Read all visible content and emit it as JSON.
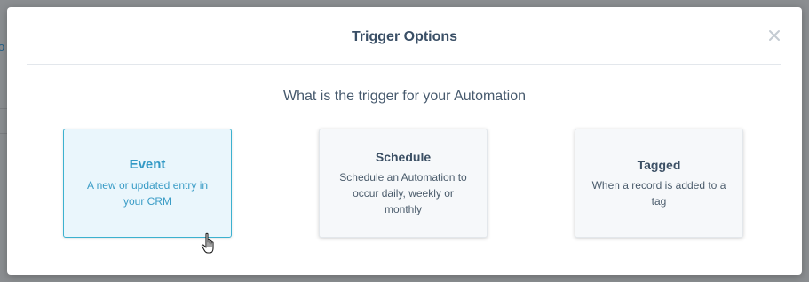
{
  "backdrop": {
    "partial_text": "o"
  },
  "modal": {
    "title": "Trigger Options",
    "close_icon": "close-icon",
    "question": "What is the trigger for your Automation",
    "options": [
      {
        "title": "Event",
        "description": "A new or updated entry in your CRM",
        "selected": true
      },
      {
        "title": "Schedule",
        "description": "Schedule an Automation to occur daily, weekly or monthly",
        "selected": false
      },
      {
        "title": "Tagged",
        "description": "When a record is added to a tag",
        "selected": false
      }
    ]
  },
  "colors": {
    "accent": "#3399c5",
    "selected_border": "#3cb1cf",
    "selected_bg": "#eaf6fc",
    "title_text": "#3a4f66",
    "backdrop": "#8b8e91"
  },
  "cursor": "hand-pointer-icon"
}
